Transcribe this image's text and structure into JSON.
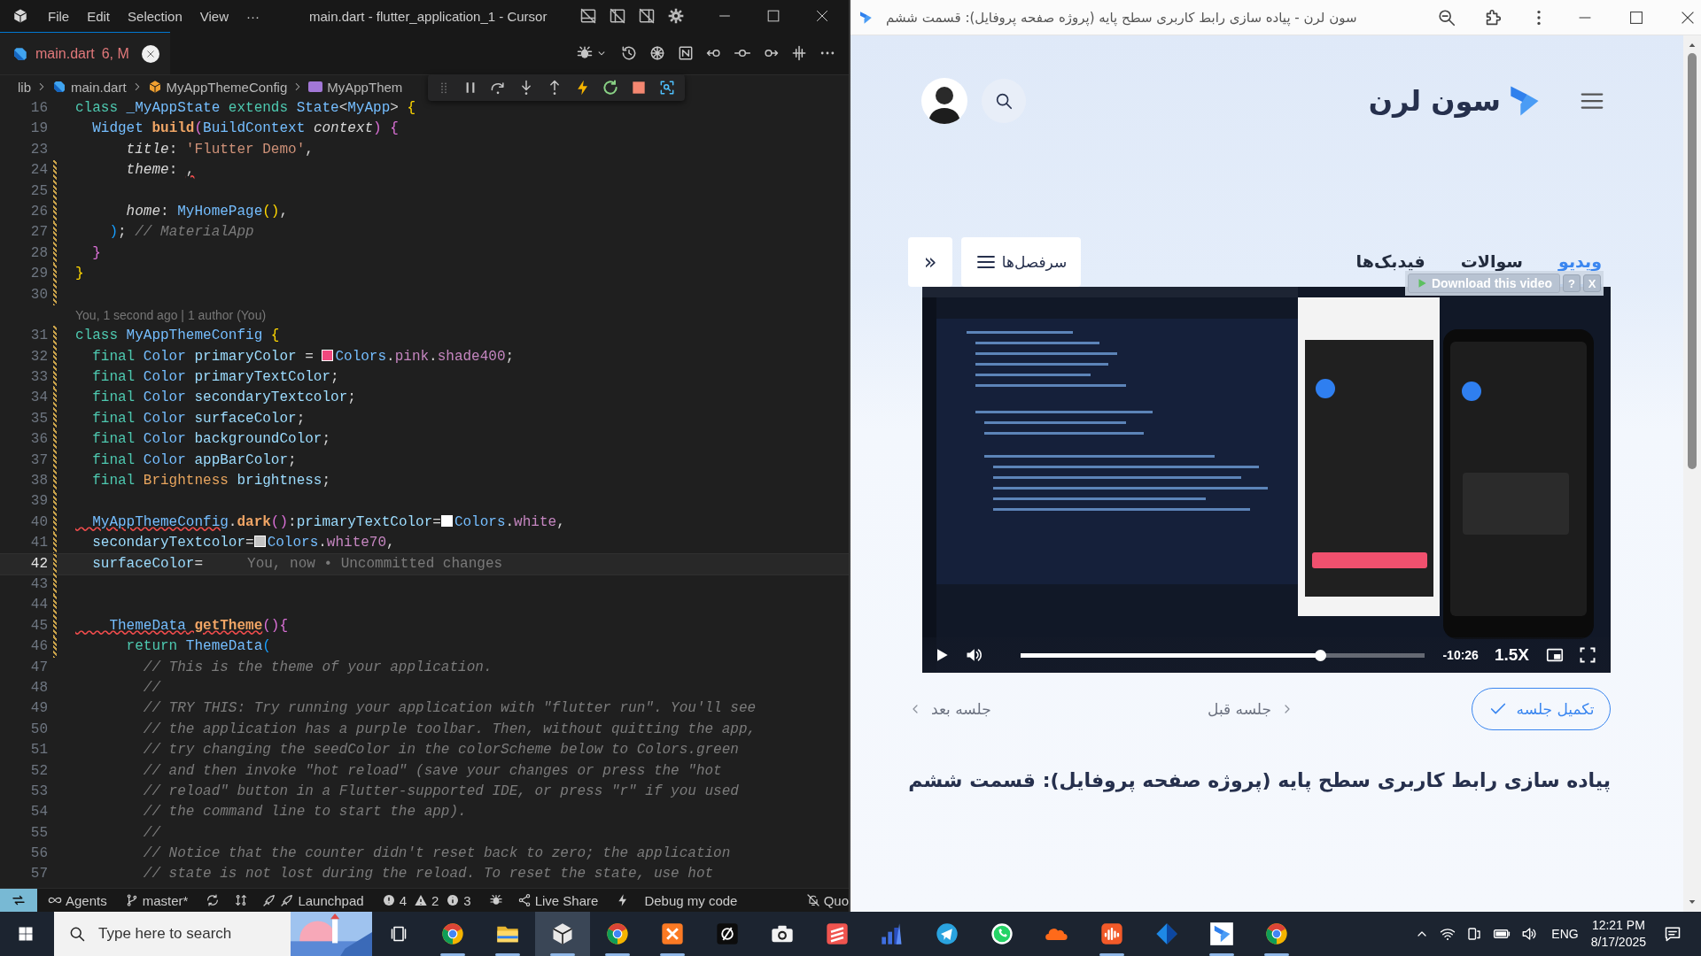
{
  "editor": {
    "menu": [
      "File",
      "Edit",
      "Selection",
      "View",
      "···"
    ],
    "title": "main.dart - flutter_application_1 - Cursor",
    "tab": {
      "label": "main.dart",
      "status": "6, M"
    },
    "breadcrumb": [
      "lib",
      "main.dart",
      "MyAppThemeConfig",
      "MyAppThem"
    ],
    "lines": [
      {
        "kind": "code",
        "num": "16",
        "changed": false,
        "current": false,
        "tokens": [
          {
            "kind": "keyword",
            "t": "class "
          },
          {
            "kind": "type",
            "t": "_MyAppState "
          },
          {
            "kind": "keyword",
            "t": "extends "
          },
          {
            "kind": "type",
            "t": "State"
          },
          {
            "kind": "punctuation",
            "t": "<"
          },
          {
            "kind": "type",
            "t": "MyApp"
          },
          {
            "kind": "punctuation",
            "t": "> "
          },
          {
            "kind": "bracket1",
            "t": "{"
          }
        ]
      },
      {
        "kind": "code",
        "num": "19",
        "changed": false,
        "current": false,
        "tokens": [
          {
            "kind": "type",
            "t": "  Widget "
          },
          {
            "kind": "function",
            "t": "build"
          },
          {
            "kind": "bracket2",
            "t": "("
          },
          {
            "kind": "type",
            "t": "BuildContext "
          },
          {
            "kind": "parameter",
            "t": "context"
          },
          {
            "kind": "bracket2",
            "t": ") {"
          }
        ]
      },
      {
        "kind": "code",
        "num": "23",
        "changed": false,
        "current": false,
        "tokens": [
          {
            "kind": "parameter",
            "t": "      title"
          },
          {
            "kind": "punctuation",
            "t": ": "
          },
          {
            "kind": "string",
            "t": "'Flutter Demo'"
          },
          {
            "kind": "punctuation",
            "t": ","
          }
        ]
      },
      {
        "kind": "code",
        "num": "24",
        "changed": true,
        "current": false,
        "tokens": [
          {
            "kind": "parameter",
            "t": "      theme"
          },
          {
            "kind": "punctuation",
            "t": ": "
          },
          {
            "kind": "punctuation",
            "t": ",",
            "squiggle": true
          }
        ]
      },
      {
        "kind": "code",
        "num": "25",
        "changed": true,
        "current": false
      },
      {
        "kind": "code",
        "num": "26",
        "changed": true,
        "current": false,
        "tokens": [
          {
            "kind": "parameter",
            "t": "      home"
          },
          {
            "kind": "punctuation",
            "t": ": "
          },
          {
            "kind": "type",
            "t": "MyHomePage"
          },
          {
            "kind": "bracket1",
            "t": "()"
          },
          {
            "kind": "punctuation",
            "t": ","
          }
        ]
      },
      {
        "kind": "code",
        "num": "27",
        "changed": true,
        "current": false,
        "tokens": [
          {
            "kind": "bracket3",
            "t": "    )"
          },
          {
            "kind": "punctuation",
            "t": "; "
          },
          {
            "kind": "comment",
            "t": "// MaterialApp"
          }
        ]
      },
      {
        "kind": "code",
        "num": "28",
        "changed": true,
        "current": false,
        "tokens": [
          {
            "kind": "bracket2",
            "t": "  }"
          }
        ]
      },
      {
        "kind": "code",
        "num": "29",
        "changed": true,
        "current": false,
        "tokens": [
          {
            "kind": "bracket1",
            "t": "}"
          }
        ]
      },
      {
        "kind": "code",
        "num": "30",
        "changed": true,
        "current": false
      },
      {
        "kind": "lens",
        "text": "You, 1 second ago | 1 author (You)"
      },
      {
        "kind": "code",
        "num": "31",
        "changed": true,
        "current": false,
        "tokens": [
          {
            "kind": "keyword",
            "t": "class "
          },
          {
            "kind": "type",
            "t": "MyAppThemeConfig "
          },
          {
            "kind": "bracket1",
            "t": "{"
          }
        ]
      },
      {
        "kind": "code",
        "num": "32",
        "changed": true,
        "current": false,
        "tokens": [
          {
            "kind": "keyword",
            "t": "  final "
          },
          {
            "kind": "type",
            "t": "Color "
          },
          {
            "kind": "variable",
            "t": "primaryColor "
          },
          {
            "kind": "punctuation",
            "t": "= "
          },
          {
            "kind": "swatch",
            "color": "#f0487e"
          },
          {
            "kind": "type",
            "t": "Colors"
          },
          {
            "kind": "punctuation",
            "t": "."
          },
          {
            "kind": "property",
            "t": "pink"
          },
          {
            "kind": "punctuation",
            "t": "."
          },
          {
            "kind": "property",
            "t": "shade400"
          },
          {
            "kind": "punctuation",
            "t": ";"
          }
        ]
      },
      {
        "kind": "code",
        "num": "33",
        "changed": true,
        "current": false,
        "tokens": [
          {
            "kind": "keyword",
            "t": "  final "
          },
          {
            "kind": "type",
            "t": "Color "
          },
          {
            "kind": "variable",
            "t": "primaryTextColor"
          },
          {
            "kind": "punctuation",
            "t": ";"
          }
        ]
      },
      {
        "kind": "code",
        "num": "34",
        "changed": true,
        "current": false,
        "tokens": [
          {
            "kind": "keyword",
            "t": "  final "
          },
          {
            "kind": "type",
            "t": "Color "
          },
          {
            "kind": "variable",
            "t": "secondaryTextcolor"
          },
          {
            "kind": "punctuation",
            "t": ";"
          }
        ]
      },
      {
        "kind": "code",
        "num": "35",
        "changed": true,
        "current": false,
        "tokens": [
          {
            "kind": "keyword",
            "t": "  final "
          },
          {
            "kind": "type",
            "t": "Color "
          },
          {
            "kind": "variable",
            "t": "surfaceColor"
          },
          {
            "kind": "punctuation",
            "t": ";"
          }
        ]
      },
      {
        "kind": "code",
        "num": "36",
        "changed": true,
        "current": false,
        "tokens": [
          {
            "kind": "keyword",
            "t": "  final "
          },
          {
            "kind": "type",
            "t": "Color "
          },
          {
            "kind": "variable",
            "t": "backgroundColor"
          },
          {
            "kind": "punctuation",
            "t": ";"
          }
        ]
      },
      {
        "kind": "code",
        "num": "37",
        "changed": true,
        "current": false,
        "tokens": [
          {
            "kind": "keyword",
            "t": "  final "
          },
          {
            "kind": "type",
            "t": "Color "
          },
          {
            "kind": "variable",
            "t": "appBarColor"
          },
          {
            "kind": "punctuation",
            "t": ";"
          }
        ]
      },
      {
        "kind": "code",
        "num": "38",
        "changed": true,
        "current": false,
        "tokens": [
          {
            "kind": "keyword",
            "t": "  final "
          },
          {
            "kind": "enum",
            "t": "Brightness "
          },
          {
            "kind": "variable",
            "t": "brightness"
          },
          {
            "kind": "punctuation",
            "t": ";"
          }
        ]
      },
      {
        "kind": "code",
        "num": "39",
        "changed": true,
        "current": false
      },
      {
        "kind": "code",
        "num": "40",
        "changed": true,
        "current": false,
        "tokens": [
          {
            "kind": "type",
            "t": "  MyAppThemeConfig",
            "squiggle": true
          },
          {
            "kind": "punctuation",
            "t": "."
          },
          {
            "kind": "function",
            "t": "dark"
          },
          {
            "kind": "bracket2",
            "t": "()"
          },
          {
            "kind": "punctuation",
            "t": ":"
          },
          {
            "kind": "variable",
            "t": "primaryTextColor"
          },
          {
            "kind": "punctuation",
            "t": "="
          },
          {
            "kind": "swatch",
            "color": "#ffffff"
          },
          {
            "kind": "type",
            "t": "Colors"
          },
          {
            "kind": "punctuation",
            "t": "."
          },
          {
            "kind": "property",
            "t": "white"
          },
          {
            "kind": "punctuation",
            "t": ","
          }
        ]
      },
      {
        "kind": "code",
        "num": "41",
        "changed": true,
        "current": false,
        "tokens": [
          {
            "kind": "variable",
            "t": "  secondaryTextcolor"
          },
          {
            "kind": "punctuation",
            "t": "="
          },
          {
            "kind": "swatch",
            "color": "#c4c4c4"
          },
          {
            "kind": "type",
            "t": "Colors"
          },
          {
            "kind": "punctuation",
            "t": "."
          },
          {
            "kind": "property",
            "t": "white70"
          },
          {
            "kind": "punctuation",
            "t": ","
          }
        ]
      },
      {
        "kind": "code",
        "num": "42",
        "changed": true,
        "current": true,
        "tokens": [
          {
            "kind": "variable",
            "t": "  surfaceColor"
          },
          {
            "kind": "punctuation",
            "t": "="
          }
        ],
        "ghost": "You, now • Uncommitted changes"
      },
      {
        "kind": "code",
        "num": "43",
        "changed": true,
        "current": false
      },
      {
        "kind": "code",
        "num": "44",
        "changed": true,
        "current": false
      },
      {
        "kind": "code",
        "num": "45",
        "changed": true,
        "current": false,
        "tokens": [
          {
            "kind": "type",
            "t": "    ThemeData",
            "squiggle": true
          },
          {
            "kind": "function",
            "t": " getTheme",
            "squiggle": true
          },
          {
            "kind": "bracket2",
            "t": "(){"
          }
        ]
      },
      {
        "kind": "code",
        "num": "46",
        "changed": true,
        "current": false,
        "tokens": [
          {
            "kind": "keyword",
            "t": "      return "
          },
          {
            "kind": "type",
            "t": "ThemeData"
          },
          {
            "kind": "bracket3",
            "t": "("
          }
        ]
      },
      {
        "kind": "code",
        "num": "47",
        "changed": false,
        "current": false,
        "tokens": [
          {
            "kind": "comment",
            "t": "        // This is the theme of your application."
          }
        ]
      },
      {
        "kind": "code",
        "num": "48",
        "changed": false,
        "current": false,
        "tokens": [
          {
            "kind": "comment",
            "t": "        //"
          }
        ]
      },
      {
        "kind": "code",
        "num": "49",
        "changed": false,
        "current": false,
        "tokens": [
          {
            "kind": "comment",
            "t": "        // TRY THIS: Try running your application with \"flutter run\". You'll see"
          }
        ]
      },
      {
        "kind": "code",
        "num": "50",
        "changed": false,
        "current": false,
        "tokens": [
          {
            "kind": "comment",
            "t": "        // the application has a purple toolbar. Then, without quitting the app,"
          }
        ]
      },
      {
        "kind": "code",
        "num": "51",
        "changed": false,
        "current": false,
        "tokens": [
          {
            "kind": "comment",
            "t": "        // try changing the seedColor in the colorScheme below to Colors.green"
          }
        ]
      },
      {
        "kind": "code",
        "num": "52",
        "changed": false,
        "current": false,
        "tokens": [
          {
            "kind": "comment",
            "t": "        // and then invoke \"hot reload\" (save your changes or press the \"hot"
          }
        ]
      },
      {
        "kind": "code",
        "num": "53",
        "changed": false,
        "current": false,
        "tokens": [
          {
            "kind": "comment",
            "t": "        // reload\" button in a Flutter-supported IDE, or press \"r\" if you used"
          }
        ]
      },
      {
        "kind": "code",
        "num": "54",
        "changed": false,
        "current": false,
        "tokens": [
          {
            "kind": "comment",
            "t": "        // the command line to start the app)."
          }
        ]
      },
      {
        "kind": "code",
        "num": "55",
        "changed": false,
        "current": false,
        "tokens": [
          {
            "kind": "comment",
            "t": "        //"
          }
        ]
      },
      {
        "kind": "code",
        "num": "56",
        "changed": false,
        "current": false,
        "tokens": [
          {
            "kind": "comment",
            "t": "        // Notice that the counter didn't reset back to zero; the application"
          }
        ]
      },
      {
        "kind": "code",
        "num": "57",
        "changed": false,
        "current": false,
        "tokens": [
          {
            "kind": "comment",
            "t": "        // state is not lost during the reload. To reset the state, use hot"
          }
        ]
      }
    ],
    "status_bar": {
      "agents": "Agents",
      "branch": "master*",
      "launchpad": "Launchpad",
      "errors": "4",
      "warnings": "2",
      "infos": "3",
      "live_share": "Live Share",
      "debug": "Debug my code",
      "cut_item": "Quo"
    }
  },
  "browser": {
    "title": "سون لرن - پیاده سازی رابط کاربری سطح پایه (پروژه صفحه پروفایل): قسمت ششم",
    "logo": "سون لرن",
    "tabs": [
      {
        "label": "ویدیو",
        "selected": true
      },
      {
        "label": "سوالات",
        "selected": false
      },
      {
        "label": "فیدبک‌ها",
        "selected": false
      }
    ],
    "chapters_button": "سرفصل‌ها",
    "collapse_button": "»",
    "download_overlay": {
      "label": "Download this video",
      "help": "?",
      "close": "X"
    },
    "video": {
      "kind": "picture",
      "remaining": "-10:26",
      "speed": "1.5X",
      "progress": {
        "level": 0.74
      }
    },
    "complete_button": "تکمیل جلسه",
    "prev": "جلسه قبل",
    "next": "جلسه بعد",
    "heading": "پیاده سازی رابط کاربری سطح پایه (پروژه صفحه پروفایل): قسمت ششم"
  },
  "taskbar": {
    "search_placeholder": "Type here to search",
    "apps": [
      {
        "kind": "chrome",
        "running": true,
        "active": false
      },
      {
        "kind": "folder",
        "running": true,
        "active": false
      },
      {
        "kind": "cube",
        "running": true,
        "active": true
      },
      {
        "kind": "chrome",
        "running": true,
        "active": false
      },
      {
        "kind": "xampp",
        "running": true,
        "active": false
      },
      {
        "kind": "slash",
        "running": false,
        "active": false
      },
      {
        "kind": "camera",
        "running": false,
        "active": false
      },
      {
        "kind": "stripes",
        "running": false,
        "active": false
      },
      {
        "kind": "chart",
        "running": false,
        "active": false
      },
      {
        "kind": "telegram",
        "running": false,
        "active": false
      },
      {
        "kind": "whatsapp",
        "running": false,
        "active": false
      },
      {
        "kind": "cloud",
        "running": false,
        "active": false
      },
      {
        "kind": "wave",
        "running": true,
        "active": false
      },
      {
        "kind": "diamond",
        "running": false,
        "active": false
      },
      {
        "kind": "logo",
        "running": true,
        "active": false
      },
      {
        "kind": "chrome",
        "running": true,
        "active": false
      }
    ],
    "language": "ENG",
    "time": "12:21 PM",
    "date": "8/17/2025"
  }
}
